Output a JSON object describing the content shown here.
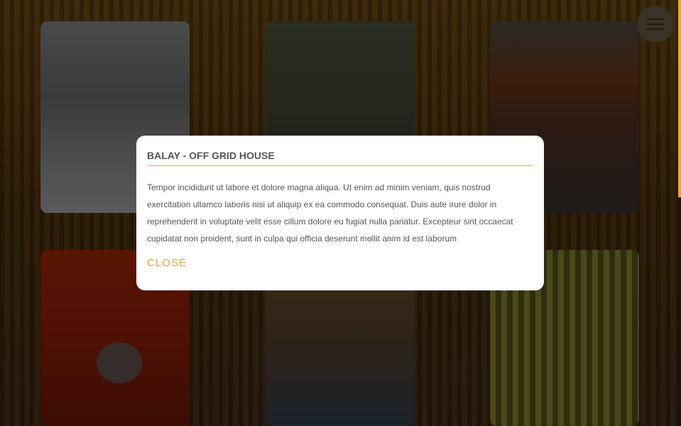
{
  "modal": {
    "title": "BALAY - OFF GRID HOUSE",
    "body": "Tempor incididunt ut labore et dolore magna aliqua. Ut enim ad minim veniam, quis nostrud exercitation ullamco laboris nisi ut aliquip ex ea commodo consequat. Duis aute irure dolor in reprehenderit in voluptate velit esse cillum dolore eu fugiat nulla pariatur. Excepteur sint occaecat cupidatat non proident, sunt in culpa qui officia deserunt mollit anim id est laborum",
    "close_label": "CLOSE"
  },
  "menu": {
    "icon": "hamburger-icon"
  },
  "colors": {
    "accent": "#e9a63a",
    "divider": "#e9b443"
  }
}
